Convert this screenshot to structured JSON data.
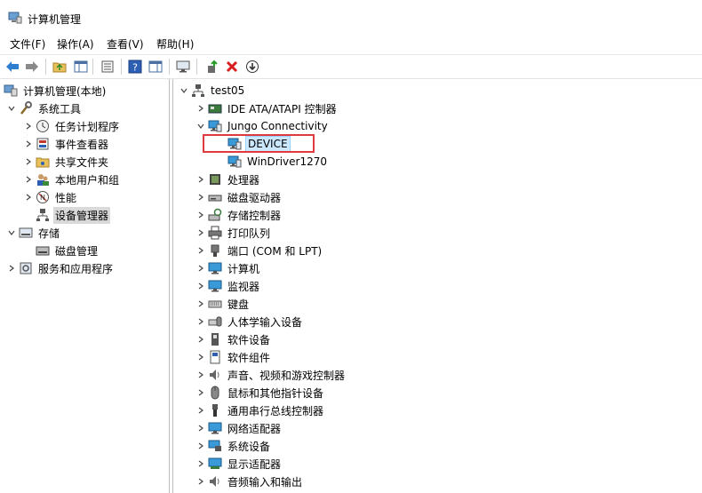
{
  "window": {
    "title": "计算机管理"
  },
  "menu": {
    "file": "文件(F)",
    "action": "操作(A)",
    "view": "查看(V)",
    "help": "帮助(H)"
  },
  "toolbar": {
    "icons": [
      "back-arrow-icon",
      "forward-arrow-icon",
      "up-folder-icon",
      "show-hide-tree-icon",
      "properties-icon",
      "help-icon",
      "action-pane-icon",
      "monitor-icon",
      "update-driver-icon",
      "uninstall-icon",
      "disable-device-icon"
    ]
  },
  "left_tree": {
    "root": "计算机管理(本地)",
    "system_tools": "系统工具",
    "task_scheduler": "任务计划程序",
    "event_viewer": "事件查看器",
    "shared_folders": "共享文件夹",
    "local_users": "本地用户和组",
    "performance": "性能",
    "device_manager": "设备管理器",
    "storage": "存储",
    "disk_management": "磁盘管理",
    "services_apps": "服务和应用程序"
  },
  "right_tree": {
    "root": "test05",
    "ide": "IDE ATA/ATAPI 控制器",
    "jungo": "Jungo Connectivity",
    "device": "DEVICE",
    "windriver": "WinDriver1270",
    "processor": "处理器",
    "disk_drives": "磁盘驱动器",
    "storage_controllers": "存储控制器",
    "print_queues": "打印队列",
    "ports": "端口 (COM 和 LPT)",
    "computer": "计算机",
    "monitors": "监视器",
    "keyboards": "键盘",
    "hid": "人体学输入设备",
    "software_devices": "软件设备",
    "software_components": "软件组件",
    "sound": "声音、视频和游戏控制器",
    "mice": "鼠标和其他指针设备",
    "usb": "通用串行总线控制器",
    "network": "网络适配器",
    "system_devices": "系统设备",
    "display": "显示适配器",
    "audio_io": "音频输入和输出"
  }
}
